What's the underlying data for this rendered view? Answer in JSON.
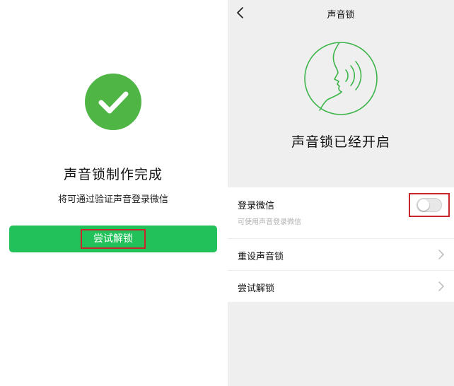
{
  "left": {
    "title": "声音锁制作完成",
    "subtitle": "将可通过验证声音登录微信",
    "try_button": "尝试解锁",
    "accent_color": "#22c15a"
  },
  "right": {
    "nav_title": "声音锁",
    "status_text": "声音锁已经开启",
    "login_row": {
      "label": "登录微信",
      "sub": "可使用声音登录微信",
      "toggle_on": false
    },
    "rows": [
      {
        "label": "重设声音锁"
      },
      {
        "label": "尝试解锁"
      }
    ]
  },
  "icons": {
    "check": "checkmark-icon",
    "back": "back-arrow-icon",
    "voice": "voice-profile-icon",
    "chevron": "chevron-right-icon"
  }
}
